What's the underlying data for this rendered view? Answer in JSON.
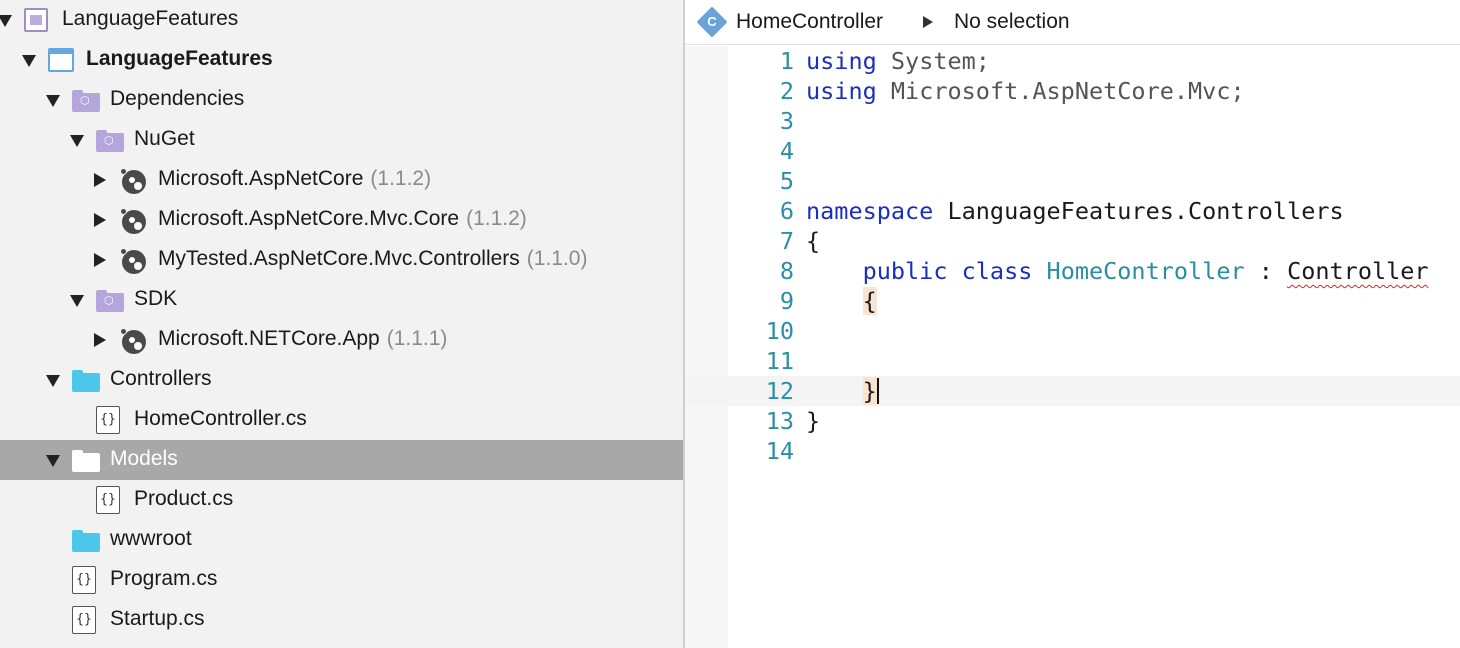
{
  "solution_tree": [
    {
      "label": "LanguageFeatures",
      "icon": "solution-icon",
      "depth": 0,
      "arrow": "open",
      "bold": false
    },
    {
      "label": "LanguageFeatures",
      "icon": "project-icon",
      "depth": 1,
      "arrow": "open",
      "bold": true
    },
    {
      "label": "Dependencies",
      "icon": "dependencies-folder-icon",
      "depth": 2,
      "arrow": "open"
    },
    {
      "label": "NuGet",
      "icon": "nuget-folder-icon",
      "depth": 3,
      "arrow": "open"
    },
    {
      "label": "Microsoft.AspNetCore",
      "version": "(1.1.2)",
      "icon": "package-icon",
      "depth": 4,
      "arrow": "closed"
    },
    {
      "label": "Microsoft.AspNetCore.Mvc.Core",
      "version": "(1.1.2)",
      "icon": "package-icon",
      "depth": 4,
      "arrow": "closed"
    },
    {
      "label": "MyTested.AspNetCore.Mvc.Controllers",
      "version": "(1.1.0)",
      "icon": "package-icon",
      "depth": 4,
      "arrow": "closed"
    },
    {
      "label": "SDK",
      "icon": "sdk-folder-icon",
      "depth": 3,
      "arrow": "open"
    },
    {
      "label": "Microsoft.NETCore.App",
      "version": "(1.1.1)",
      "icon": "package-icon",
      "depth": 4,
      "arrow": "closed"
    },
    {
      "label": "Controllers",
      "icon": "folder-icon",
      "depth": 2,
      "arrow": "open"
    },
    {
      "label": "HomeController.cs",
      "icon": "csharp-file-icon",
      "depth": 3
    },
    {
      "label": "Models",
      "icon": "folder-icon",
      "depth": 2,
      "arrow": "open",
      "selected": true
    },
    {
      "label": "Product.cs",
      "icon": "csharp-file-icon",
      "depth": 3
    },
    {
      "label": "wwwroot",
      "icon": "folder-icon",
      "depth": 2
    },
    {
      "label": "Program.cs",
      "icon": "csharp-file-icon",
      "depth": 2
    },
    {
      "label": "Startup.cs",
      "icon": "csharp-file-icon",
      "depth": 2
    }
  ],
  "editor": {
    "pathbar": {
      "class_icon_letter": "C",
      "class_name": "HomeController",
      "member": "No selection"
    },
    "current_line": 12,
    "lines": [
      {
        "n": "1",
        "tokens": [
          {
            "t": "using",
            "c": "kw"
          },
          {
            "t": " "
          },
          {
            "t": "System;",
            "c": "ns"
          }
        ]
      },
      {
        "n": "2",
        "tokens": [
          {
            "t": "using",
            "c": "kw"
          },
          {
            "t": " "
          },
          {
            "t": "Microsoft.AspNetCore.Mvc;",
            "c": "ns"
          }
        ]
      },
      {
        "n": "3",
        "tokens": []
      },
      {
        "n": "4",
        "tokens": []
      },
      {
        "n": "5",
        "tokens": []
      },
      {
        "n": "6",
        "tokens": [
          {
            "t": "namespace",
            "c": "kw"
          },
          {
            "t": " LanguageFeatures.Controllers"
          }
        ]
      },
      {
        "n": "7",
        "tokens": [
          {
            "t": "{"
          }
        ]
      },
      {
        "n": "8",
        "tokens": [
          {
            "t": "    "
          },
          {
            "t": "public",
            "c": "kw"
          },
          {
            "t": " "
          },
          {
            "t": "class",
            "c": "kw"
          },
          {
            "t": " "
          },
          {
            "t": "HomeController",
            "c": "type"
          },
          {
            "t": " : "
          },
          {
            "t": "Controller",
            "c": "err"
          }
        ]
      },
      {
        "n": "9",
        "tokens": [
          {
            "t": "    "
          },
          {
            "t": "{",
            "c": "brace-hl"
          }
        ]
      },
      {
        "n": "10",
        "tokens": []
      },
      {
        "n": "11",
        "tokens": []
      },
      {
        "n": "12",
        "tokens": [
          {
            "t": "    "
          },
          {
            "t": "}",
            "c": "brace-hl"
          },
          {
            "caret": true
          }
        ]
      },
      {
        "n": "13",
        "tokens": [
          {
            "t": "}"
          }
        ]
      },
      {
        "n": "14",
        "tokens": []
      }
    ]
  },
  "colors": {
    "keyword": "#1a2fc0",
    "type": "#2a8ea3",
    "line_number": "#2b8fa5",
    "selection": "#a8a8a8"
  }
}
